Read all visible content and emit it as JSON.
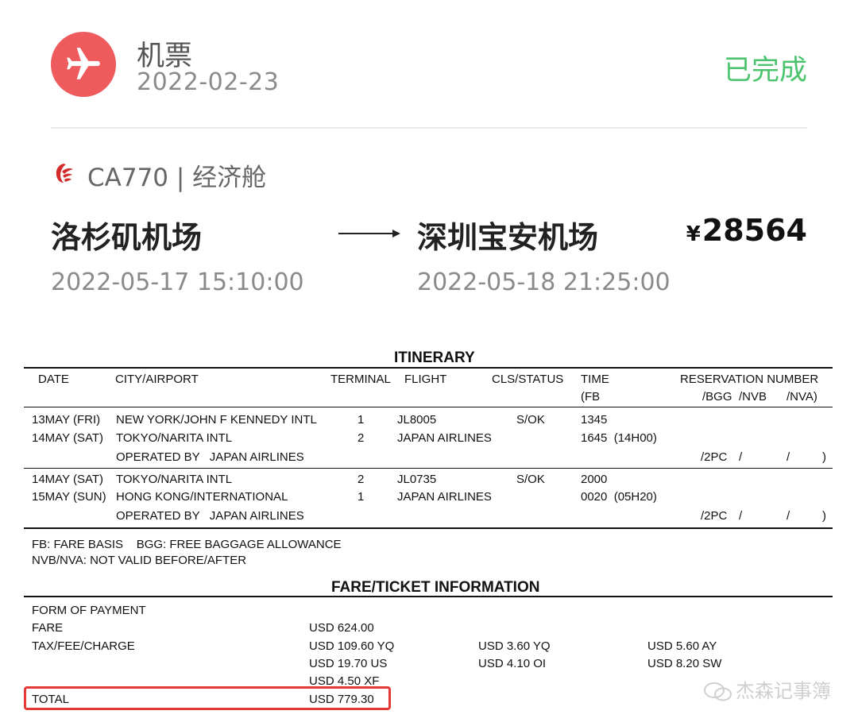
{
  "header": {
    "category": "机票",
    "date": "2022-02-23",
    "status": "已完成",
    "status_color": "#4cc46e",
    "icon": "airplane-icon",
    "icon_color": "#ef5a5c"
  },
  "flight": {
    "number_class": "CA770 | 经济舱",
    "airline_logo": "air-china-logo",
    "from": "洛杉矶机场",
    "to": "深圳宝安机场",
    "currency_symbol": "¥",
    "price": "28564",
    "departure": "2022-05-17 15:10:00",
    "arrival": "2022-05-18 21:25:00"
  },
  "itinerary": {
    "title": "ITINERARY",
    "headers": {
      "date": "DATE",
      "city": "CITY/AIRPORT",
      "terminal": "TERMINAL",
      "flight": "FLIGHT",
      "cls": "CLS/STATUS",
      "time": "TIME",
      "time2": "(FB",
      "reservation": "RESERVATION NUMBER",
      "bgg": "/BGG",
      "nvb": "/NVB",
      "nva": "/NVA)"
    },
    "rows": [
      {
        "date": "13MAY (FRI)",
        "city": "NEW YORK/JOHN F KENNEDY INTL",
        "terminal": "1",
        "flight": "JL8005",
        "status": "S/OK",
        "time": "1345"
      },
      {
        "date": "14MAY (SAT)",
        "city": "TOKYO/NARITA INTL",
        "terminal": "2",
        "flight": "JAPAN AIRLINES",
        "status": "",
        "time": "1645  (14H00)"
      },
      {
        "date": "",
        "city": "OPERATED BY   JAPAN AIRLINES",
        "terminal": "",
        "flight": "",
        "status": "",
        "time": "",
        "bgg": "/2PC",
        "nvb": "/",
        "nva": "/",
        "close": ")"
      },
      {
        "date": "14MAY (SAT)",
        "city": "TOKYO/NARITA INTL",
        "terminal": "2",
        "flight": "JL0735",
        "status": "S/OK",
        "time": "2000"
      },
      {
        "date": "15MAY (SUN)",
        "city": "HONG KONG/INTERNATIONAL",
        "terminal": "1",
        "flight": "JAPAN AIRLINES",
        "status": "",
        "time": "0020  (05H20)"
      },
      {
        "date": "",
        "city": "OPERATED BY   JAPAN AIRLINES",
        "terminal": "",
        "flight": "",
        "status": "",
        "time": "",
        "bgg": "/2PC",
        "nvb": "/",
        "nva": "/",
        "close": ")"
      }
    ],
    "notes": [
      "FB: FARE BASIS    BGG: FREE BAGGAGE ALLOWANCE",
      "NVB/NVA: NOT VALID BEFORE/AFTER"
    ]
  },
  "fare": {
    "title": "FARE/TICKET INFORMATION",
    "form_of_payment_label": "FORM OF PAYMENT",
    "fare_label": "FARE",
    "fare_value": "USD 624.00",
    "tax_label": "TAX/FEE/CHARGE",
    "taxes": [
      [
        "USD 109.60 YQ",
        "USD 3.60 YQ",
        "USD 5.60 AY"
      ],
      [
        "USD 19.70 US",
        "USD 4.10 OI",
        "USD 8.20 SW"
      ],
      [
        "USD 4.50 XF",
        "",
        ""
      ]
    ],
    "total_label": "TOTAL",
    "total_value": "USD 779.30",
    "highlight_color": "#e53935"
  },
  "watermark": "杰森记事簿"
}
